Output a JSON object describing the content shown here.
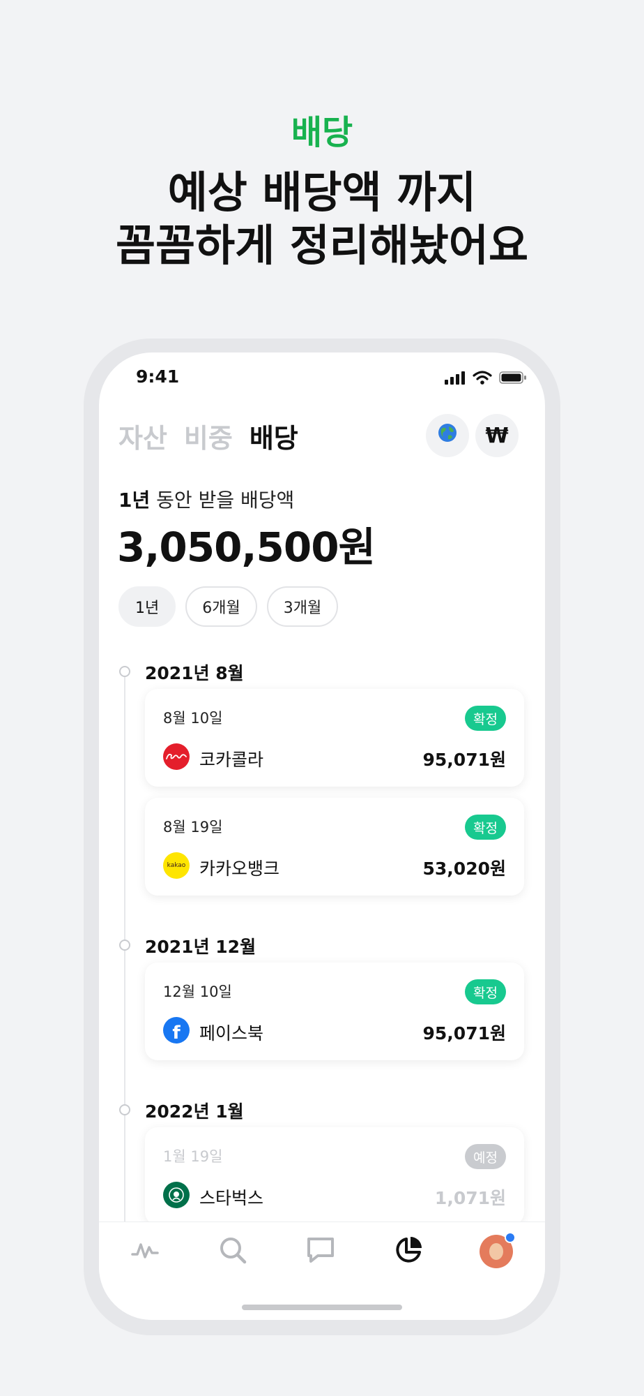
{
  "promo": {
    "eyebrow": "배당",
    "headline_line1": "예상 배당액 까지",
    "headline_line2": "꼼꼼하게 정리해놨어요"
  },
  "status_bar": {
    "time": "9:41"
  },
  "tabs": [
    {
      "label": "자산",
      "active": false
    },
    {
      "label": "비중",
      "active": false
    },
    {
      "label": "배당",
      "active": true
    }
  ],
  "header_buttons": {
    "currency_symbol": "₩"
  },
  "summary": {
    "period_bold": "1년",
    "label_rest": " 동안 받을 배당액",
    "amount": "3,050,500원"
  },
  "period_chips": [
    {
      "label": "1년",
      "active": true
    },
    {
      "label": "6개월",
      "active": false
    },
    {
      "label": "3개월",
      "active": false
    }
  ],
  "months": [
    {
      "label": "2021년 8월",
      "items": [
        {
          "date": "8월 10일",
          "status": "확정",
          "company": "코카콜라",
          "amount": "95,071원",
          "logo": "coca-cola-logo",
          "logo_color": "#e41e2b"
        },
        {
          "date": "8월 19일",
          "status": "확정",
          "company": "카카오뱅크",
          "amount": "53,020원",
          "logo": "kakao-logo",
          "logo_color": "#fee500",
          "logo_text": "kakao"
        }
      ]
    },
    {
      "label": "2021년 12월",
      "items": [
        {
          "date": "12월 10일",
          "status": "확정",
          "company": "페이스북",
          "amount": "95,071원",
          "logo": "facebook-logo",
          "logo_color": "#1877f2",
          "logo_text": "f"
        }
      ]
    },
    {
      "label": "2022년 1월",
      "items": [
        {
          "date": "1월 19일",
          "status": "예정",
          "company": "스타벅스",
          "amount": "1,071원",
          "logo": "starbucks-logo",
          "logo_color": "#00704a"
        }
      ]
    }
  ],
  "colors": {
    "accent_green": "#18b24f",
    "badge_confirmed": "#18c98f",
    "badge_expected": "#c9cbcf",
    "notification_dot": "#2a7bf4"
  },
  "bottom_nav": [
    {
      "icon": "activity-icon",
      "active": false
    },
    {
      "icon": "search-icon",
      "active": false
    },
    {
      "icon": "chat-icon",
      "active": false
    },
    {
      "icon": "pie-chart-icon",
      "active": true
    },
    {
      "icon": "profile-avatar",
      "active": false
    }
  ]
}
